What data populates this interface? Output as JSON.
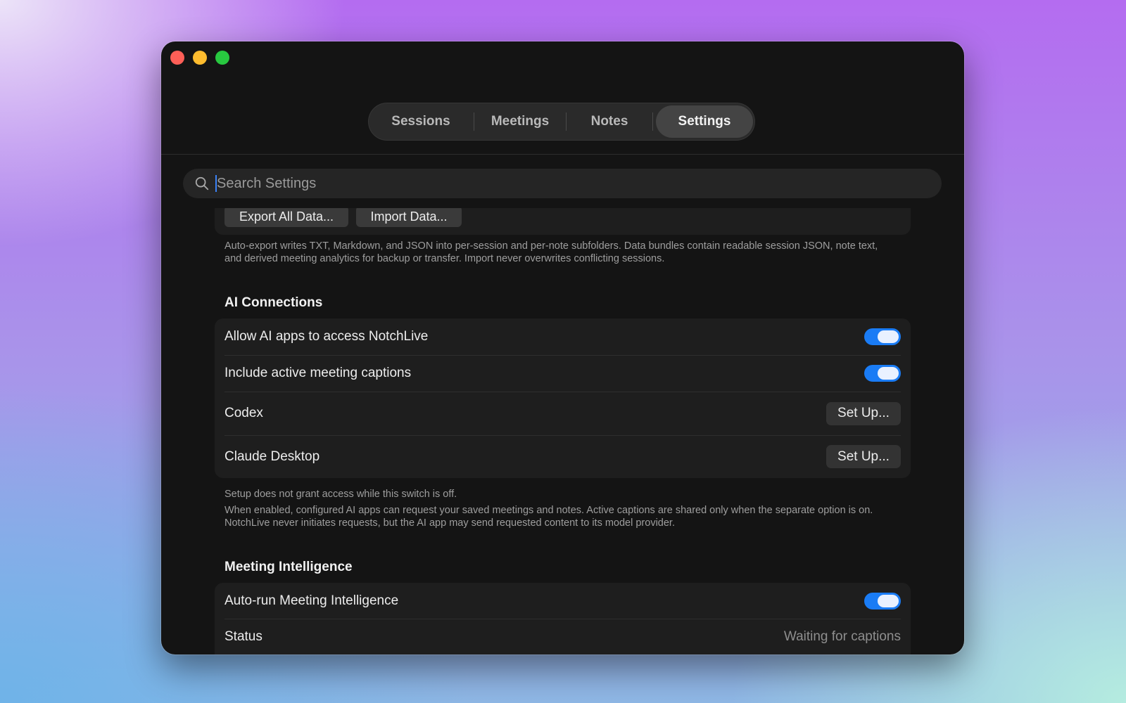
{
  "window": {
    "controls": [
      "close",
      "minimize",
      "maximize"
    ]
  },
  "tabs": [
    {
      "label": "Sessions",
      "active": false
    },
    {
      "label": "Meetings",
      "active": false
    },
    {
      "label": "Notes",
      "active": false
    },
    {
      "label": "Settings",
      "active": true
    }
  ],
  "search": {
    "placeholder": "Search Settings",
    "value": "",
    "icon": "search-icon"
  },
  "data_section": {
    "export_label": "Export All Data...",
    "import_label": "Import Data...",
    "description": "Auto-export writes TXT, Markdown, and JSON into per-session and per-note subfolders. Data bundles contain readable session JSON, note text, and derived meeting analytics for backup or transfer. Import never overwrites conflicting sessions."
  },
  "ai_connections": {
    "heading": "AI Connections",
    "rows": [
      {
        "label": "Allow AI apps to access NotchLive",
        "type": "toggle",
        "on": true
      },
      {
        "label": "Include active meeting captions",
        "type": "toggle",
        "on": true
      },
      {
        "label": "Codex",
        "type": "button",
        "button_label": "Set Up..."
      },
      {
        "label": "Claude Desktop",
        "type": "button",
        "button_label": "Set Up..."
      }
    ],
    "note": "Setup does not grant access while this switch is off.",
    "description": "When enabled, configured AI apps can request your saved meetings and notes. Active captions are shared only when the separate option is on. NotchLive never initiates requests, but the AI app may send requested content to its model provider."
  },
  "meeting_intelligence": {
    "heading": "Meeting Intelligence",
    "rows": [
      {
        "label": "Auto-run Meeting Intelligence",
        "type": "toggle",
        "on": true
      },
      {
        "label": "Status",
        "type": "value",
        "value": "Waiting for captions"
      }
    ]
  },
  "colors": {
    "accent": "#1a7cf5",
    "window_bg": "#141414",
    "card_bg": "#1e1e1e"
  }
}
